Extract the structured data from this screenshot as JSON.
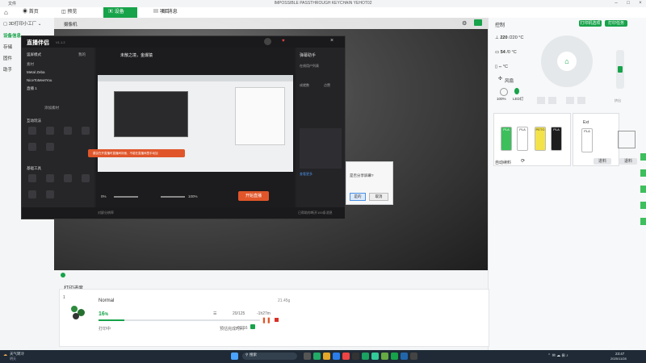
{
  "titlebar": {
    "menu": "文件",
    "title": "IMPOSSIBLE PASSTHROUGH KEYCHAIN YEHOT02"
  },
  "tabs": [
    {
      "label": "首页"
    },
    {
      "label": "预览"
    },
    {
      "label": "设备"
    },
    {
      "label": "项目"
    },
    {
      "label": "消息"
    }
  ],
  "leftnav": {
    "device_name": "3D打印小工厂",
    "items": [
      "设备信息",
      "存储",
      "固件",
      "助手"
    ]
  },
  "camera": {
    "title": "摄像机"
  },
  "live": {
    "app_name": "直播伴侣",
    "version": "V1.1.2",
    "home": "首页",
    "tab_mine": "我的",
    "mode_label": "竖屏模式",
    "sources_title": "素材",
    "sources": [
      "Metal Zeba",
      "NiceToMeetYou",
      "直播 1"
    ],
    "add_source": "添加素材",
    "interact_title": "互动玩法",
    "tools_title": "基础工具",
    "stream_title": "未散之境，金爆猿",
    "orange_banner": "建议在开直播时直播间封面，不能在直播间里手动加",
    "start_button": "开始直播",
    "assistant_title": "弹幕助手",
    "assistant_tabs": [
      "在线用户列表",
      "成就数",
      "点赞"
    ],
    "tag_text": "查看更多",
    "pct_left": "0%",
    "pct_right": "100%",
    "footer_left": "对屏分辨率",
    "footer_right": "已帮助你断开100条消息"
  },
  "dialog": {
    "message": "是否分享屏幕?",
    "ok": "是的",
    "cancel": "取消"
  },
  "right": {
    "control_title": "控制",
    "btn_print_options": "打印机选项",
    "btn_print_task": "打印任务",
    "nozzle_temp": "220",
    "nozzle_target": "/220 °C",
    "bed_temp": "54",
    "bed_target": "/0 °C",
    "chamber_temp": "--",
    "chamber_unit": "°C",
    "fan_label": "风扇",
    "fan_pct": "100%",
    "led_label": "LED灯",
    "extruder_label": "挤出",
    "spools": [
      {
        "type": "PLA",
        "color": "#3dbf5c",
        "text_color": "#ffffff"
      },
      {
        "type": "PLA",
        "color": "#ffffff",
        "text_color": "#333333"
      },
      {
        "type": "PETG",
        "color": "#f4e24a",
        "text_color": "#333333"
      },
      {
        "type": "PLA",
        "color": "#1d1d1d",
        "text_color": "#ffffff"
      }
    ],
    "ext_label": "Ext",
    "ext_type": "PLA",
    "auto_label": "自动续料",
    "btn_load": "进料",
    "btn_unload": "退料"
  },
  "print": {
    "section_title": "打印进度",
    "slot": "1",
    "profile": "Normal",
    "percent": "16",
    "percent_unit": "%",
    "layers": "20/125",
    "time_left": "-1h27m",
    "status": "打印中",
    "speed_label": "预估完成时间",
    "finish_time": "01:16",
    "weight": "21.45g",
    "progress": 0.16
  },
  "taskbar": {
    "weather": "天气转冷",
    "weather_sub": "明天",
    "search": "搜索",
    "time": "23:47",
    "date": "2025/11/28"
  }
}
